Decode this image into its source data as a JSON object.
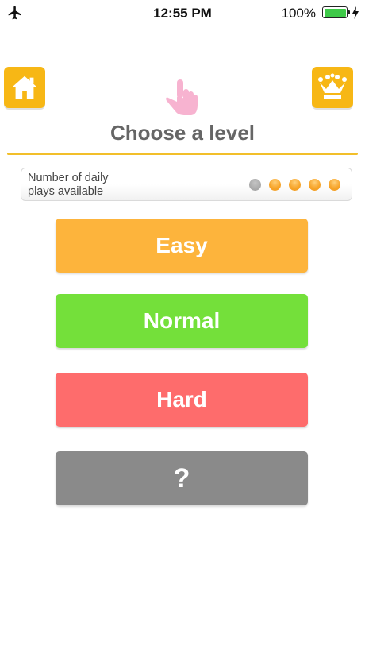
{
  "status_bar": {
    "time": "12:55 PM",
    "battery_percent": "100%",
    "airplane_icon": "airplane-icon",
    "battery_icon": "battery-icon",
    "charging_icon": "charging-bolt-icon"
  },
  "header": {
    "home_icon": "home-icon",
    "crown_icon": "crown-icon",
    "hand_icon": "pointing-hand-icon",
    "title": "Choose a level"
  },
  "daily_plays": {
    "label_line1": "Number of daily",
    "label_line2": "plays available",
    "total": 5,
    "used": 1,
    "available": 4
  },
  "levels": [
    {
      "label": "Easy",
      "color": "#fdb43c"
    },
    {
      "label": "Normal",
      "color": "#74e03a"
    },
    {
      "label": "Hard",
      "color": "#fe6c6c"
    },
    {
      "label": "?",
      "color": "#8a8a8a"
    }
  ],
  "colors": {
    "accent": "#f7b715",
    "divider": "#f2bf2a",
    "dot_available": "#f7a52b",
    "dot_used": "#a7a7a7",
    "hand": "#f7b3d0"
  }
}
